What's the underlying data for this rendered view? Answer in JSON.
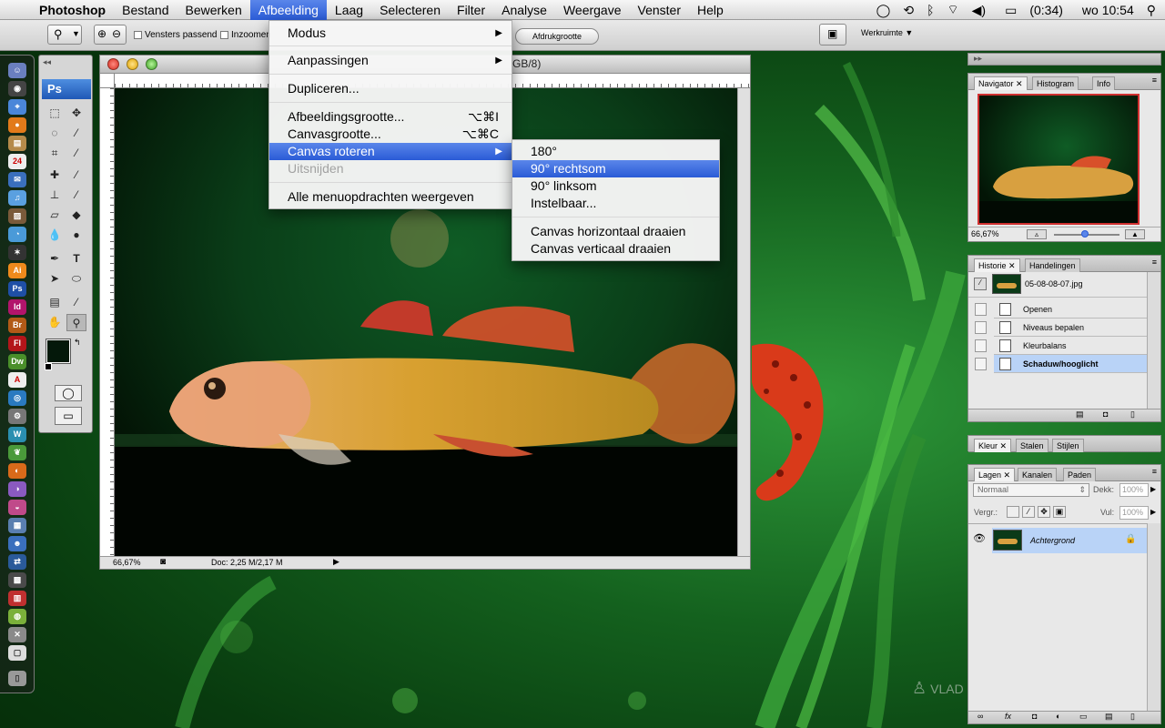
{
  "menubar": {
    "app": "Photoshop",
    "items": [
      "Bestand",
      "Bewerken",
      "Afbeelding",
      "Laag",
      "Selecteren",
      "Filter",
      "Analyse",
      "Weergave",
      "Venster",
      "Help"
    ],
    "active": "Afbeelding",
    "battery": "(0:34)",
    "clock": "wo 10:54"
  },
  "options": {
    "fit_windows_label": "Vensters passend",
    "zoom_label": "Inzoomen",
    "print_size_label": "Afdrukgrootte",
    "workspace_label": "Werkruimte"
  },
  "toolbox": {
    "logo": "Ps"
  },
  "document": {
    "title_fragment": "GB/8)",
    "zoom": "66,67%",
    "doc_size": "Doc: 2,25 M/2,17 M"
  },
  "menu": {
    "modus": "Modus",
    "aanpassingen": "Aanpassingen",
    "dupliceren": "Dupliceren...",
    "afbeeldingsgrootte": "Afbeeldingsgrootte...",
    "afbeeldingsgrootte_sc": "⌥⌘I",
    "canvasgrootte": "Canvasgrootte...",
    "canvasgrootte_sc": "⌥⌘C",
    "canvas_roteren": "Canvas roteren",
    "uitsnijden": "Uitsnijden",
    "alle": "Alle menuopdrachten weergeven"
  },
  "submenu": {
    "r180": "180°",
    "r90cw": "90° rechtsom",
    "r90ccw": "90° linksom",
    "custom": "Instelbaar...",
    "flip_h": "Canvas horizontaal draaien",
    "flip_v": "Canvas verticaal draaien"
  },
  "navigator": {
    "tabs": [
      "Navigator",
      "Histogram",
      "Info"
    ],
    "zoom": "66,67%"
  },
  "history": {
    "tabs": [
      "Historie",
      "Handelingen"
    ],
    "snapshot": "05-08-08-07.jpg",
    "steps": [
      "Openen",
      "Niveaus bepalen",
      "Kleurbalans",
      "Schaduw/hooglicht"
    ]
  },
  "color_panel": {
    "tabs": [
      "Kleur",
      "Stalen",
      "Stijlen"
    ]
  },
  "layers": {
    "tabs": [
      "Lagen",
      "Kanalen",
      "Paden"
    ],
    "blend_mode": "Normaal",
    "opacity_label": "Dekk:",
    "opacity_value": "100%",
    "lock_label": "Vergr.:",
    "fill_label": "Vul:",
    "fill_value": "100%",
    "layer_name": "Achtergrond"
  },
  "watermark": "VLAD"
}
